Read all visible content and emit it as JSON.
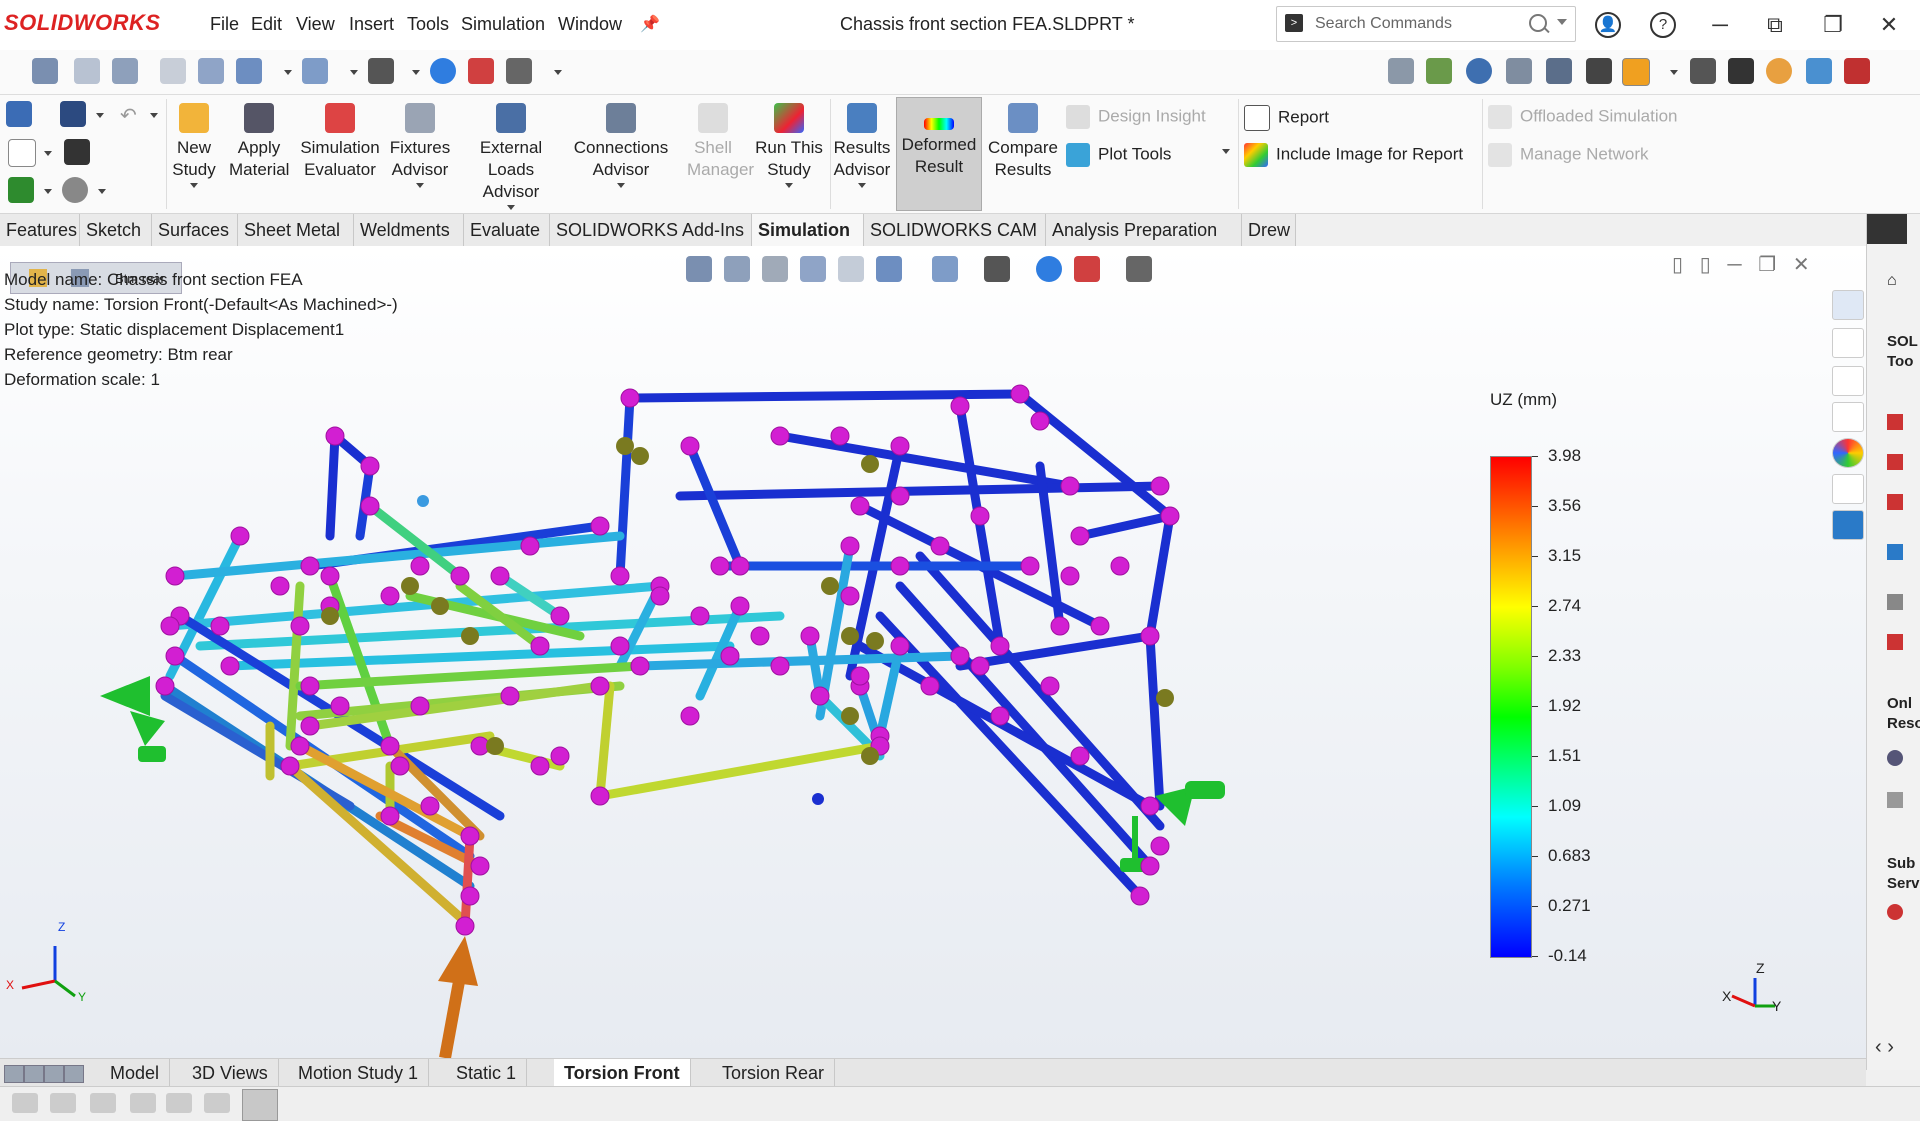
{
  "app": {
    "logo": "SOLIDWORKS",
    "title": "Chassis front section FEA.SLDPRT *"
  },
  "menu": [
    "File",
    "Edit",
    "View",
    "Insert",
    "Tools",
    "Simulation",
    "Window"
  ],
  "search": {
    "placeholder": "Search Commands"
  },
  "ribbon": {
    "new_study": "New Study",
    "apply_material": "Apply Material",
    "simulation_evaluator": "Simulation Evaluator",
    "fixtures_advisor": "Fixtures Advisor",
    "external_loads_advisor": "External Loads Advisor",
    "connections_advisor": "Connections Advisor",
    "shell_manager": "Shell Manager",
    "run_this_study": "Run This Study",
    "results_advisor": "Results Advisor",
    "deformed_result": "Deformed Result",
    "compare_results": "Compare Results",
    "design_insight": "Design Insight",
    "plot_tools": "Plot Tools",
    "report": "Report",
    "include_image": "Include Image for Report",
    "offloaded_simulation": "Offloaded Simulation",
    "manage_network": "Manage Network"
  },
  "tabs": [
    "Features",
    "Sketch",
    "Surfaces",
    "Sheet Metal",
    "Weldments",
    "Evaluate",
    "SOLIDWORKS Add-Ins",
    "Simulation",
    "SOLIDWORKS CAM",
    "Analysis Preparation",
    "Drew"
  ],
  "active_tab": "Simulation",
  "tree_tooltip": "Btm rear",
  "info": {
    "model_name": "Model name: Chassis front section FEA",
    "study_name": "Study name: Torsion Front(-Default<As Machined>-)",
    "plot_type": "Plot type: Static displacement Displacement1",
    "reference": "Reference geometry: Btm rear",
    "deformation": "Deformation scale: 1"
  },
  "legend": {
    "title": "UZ (mm)",
    "values": [
      "3.98",
      "3.56",
      "3.15",
      "2.74",
      "2.33",
      "1.92",
      "1.51",
      "1.09",
      "0.683",
      "0.271",
      "-0.14"
    ],
    "colors": [
      "#ff0000",
      "#ff8000",
      "#ffff00",
      "#80ff00",
      "#00ff00",
      "#00ffff",
      "#0080ff",
      "#0000ff"
    ]
  },
  "triad": {
    "x": "X",
    "y": "Y",
    "z": "Z"
  },
  "bottom_tabs": [
    "Model",
    "3D Views",
    "Motion Study 1",
    "Static 1",
    "Torsion Front",
    "Torsion Rear"
  ],
  "active_bottom_tab": "Torsion Front",
  "right_panel": {
    "heading1": "SOL Too",
    "heading2": "Onl Reso",
    "heading3": "Sub Serv"
  }
}
